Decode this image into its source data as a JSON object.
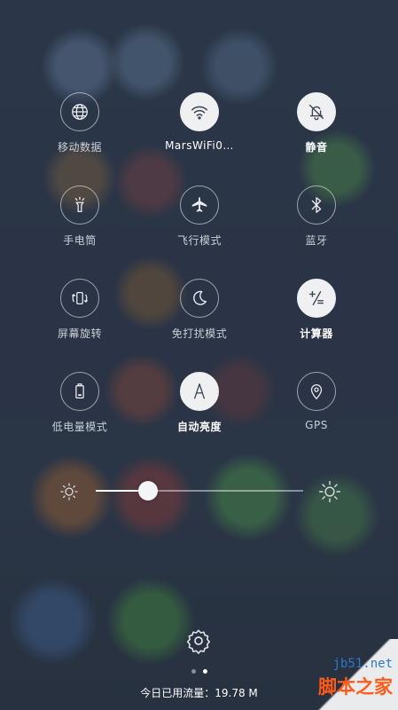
{
  "tiles": [
    {
      "label": "移动数据",
      "icon": "globe-icon",
      "on": false
    },
    {
      "label": "MarsWiFi0…",
      "icon": "wifi-icon",
      "on": true
    },
    {
      "label": "静音",
      "icon": "bell-mute-icon",
      "on": true
    },
    {
      "label": "手电筒",
      "icon": "flashlight-icon",
      "on": false
    },
    {
      "label": "飞行模式",
      "icon": "airplane-icon",
      "on": false
    },
    {
      "label": "蓝牙",
      "icon": "bluetooth-icon",
      "on": false
    },
    {
      "label": "屏幕旋转",
      "icon": "rotate-icon",
      "on": false
    },
    {
      "label": "免打扰模式",
      "icon": "moon-icon",
      "on": false
    },
    {
      "label": "计算器",
      "icon": "calculator-icon",
      "on": true
    },
    {
      "label": "低电量模式",
      "icon": "battery-icon",
      "on": false
    },
    {
      "label": "自动亮度",
      "icon": "auto-brightness-icon",
      "on": true
    },
    {
      "label": "GPS",
      "icon": "location-pin-icon",
      "on": false
    }
  ],
  "brightness": {
    "level": 0.25
  },
  "pager": {
    "pages": 2,
    "active": 2
  },
  "footer": {
    "data_usage": "今日已用流量：19.78 M"
  },
  "watermark": {
    "site": "jb51.net",
    "name": "脚本之家"
  }
}
